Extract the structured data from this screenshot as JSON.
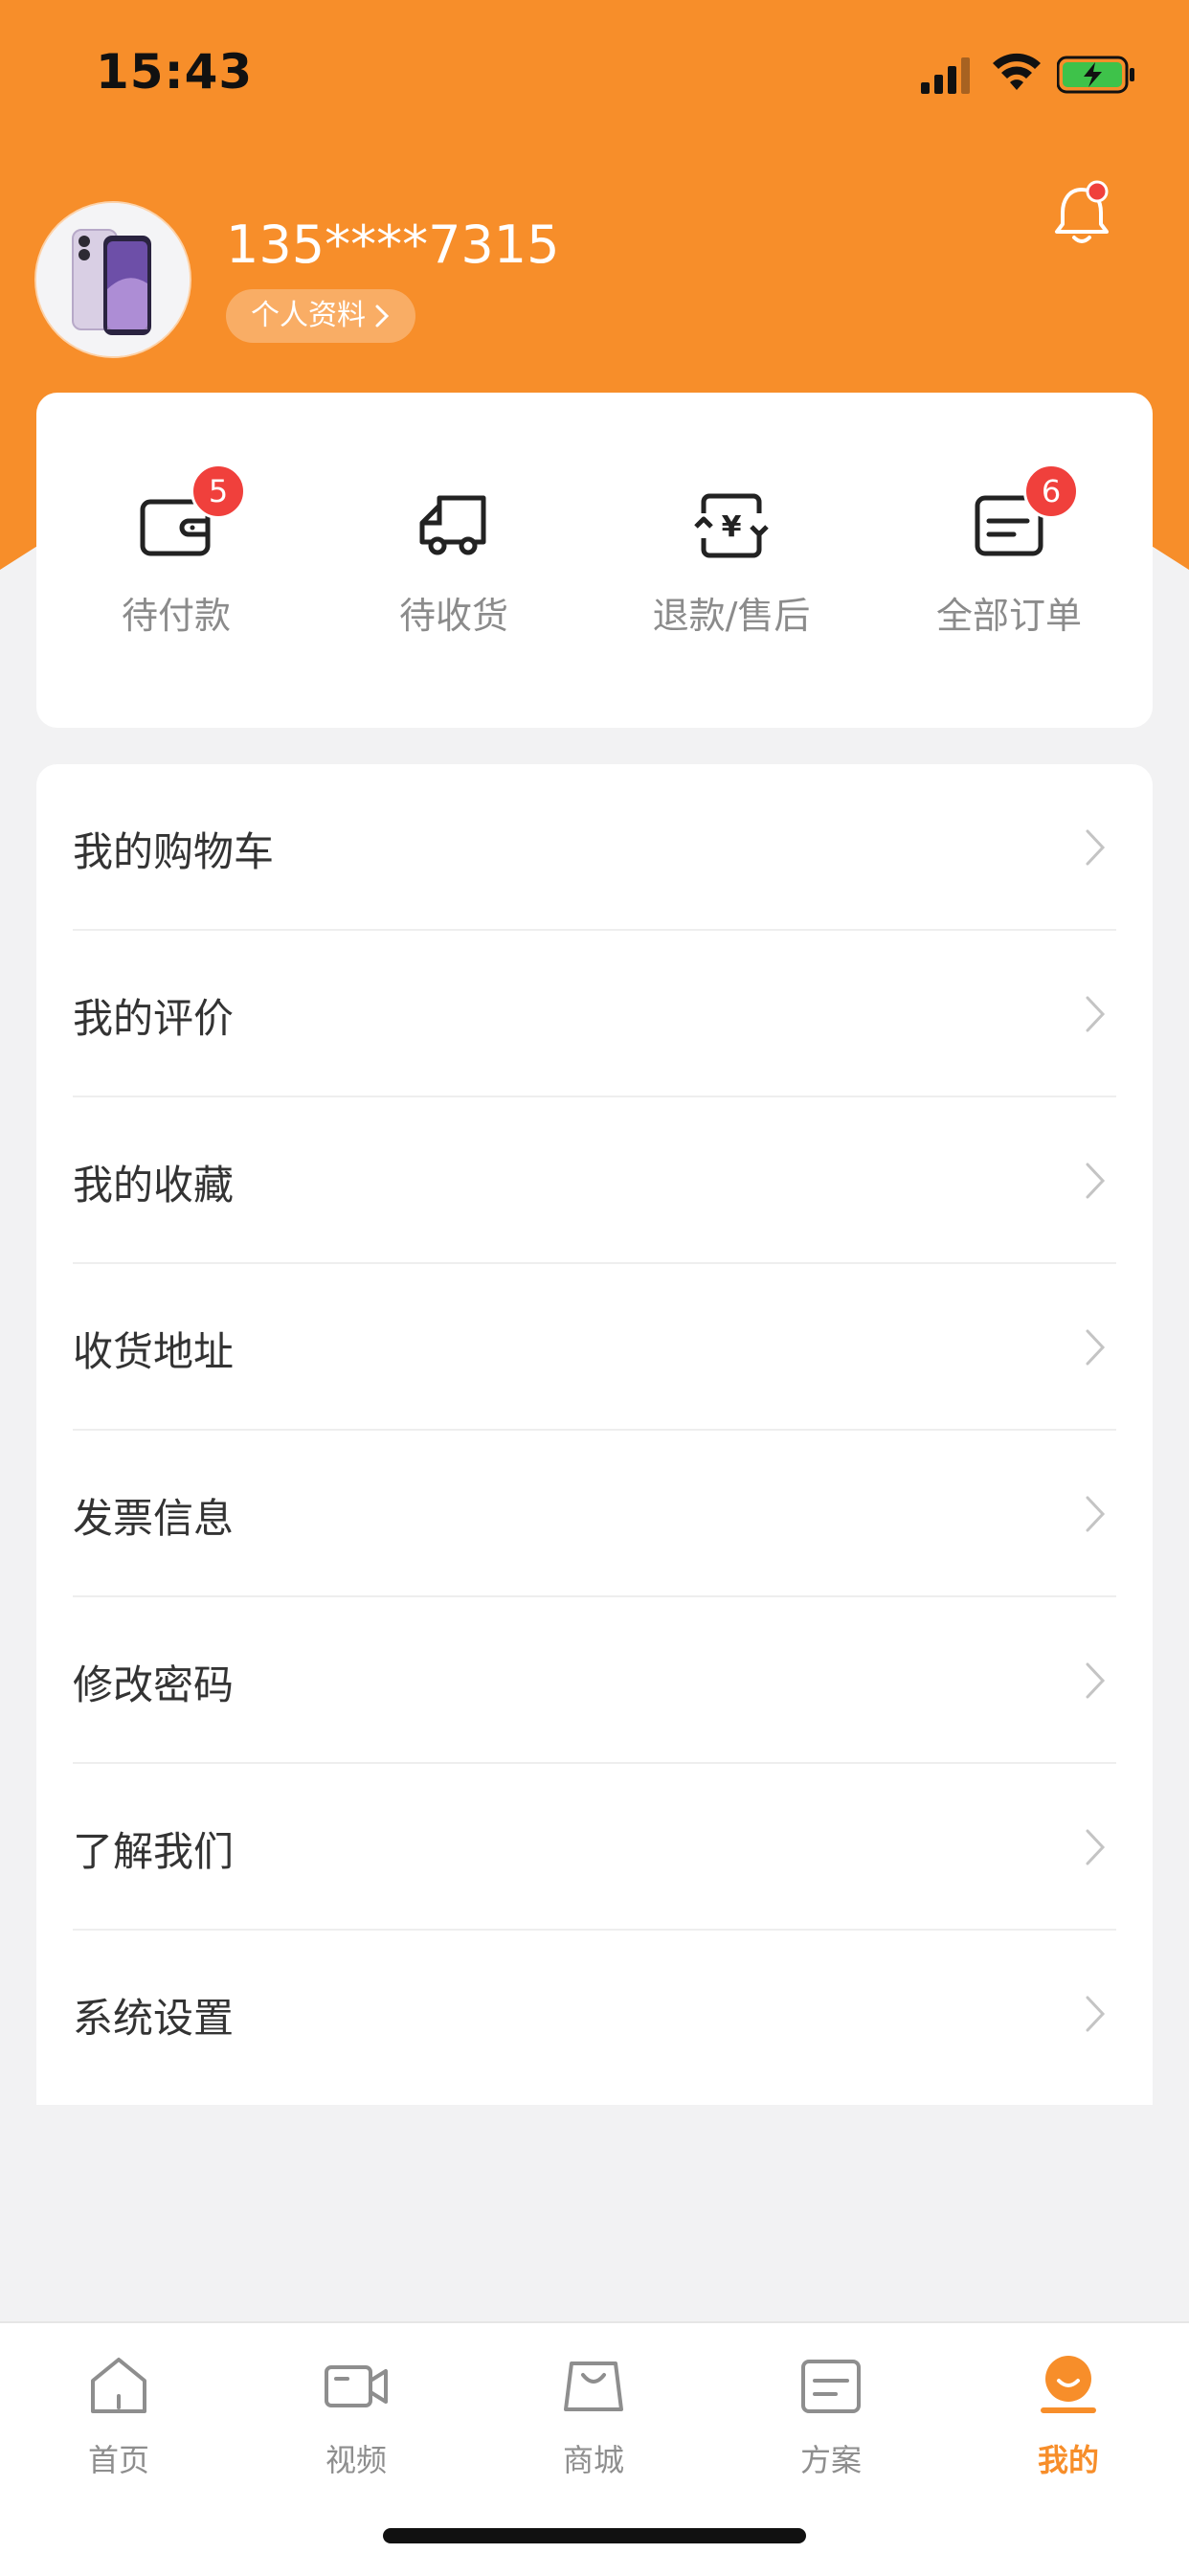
{
  "status_bar": {
    "time": "15:43"
  },
  "profile": {
    "phone": "135****7315",
    "profile_button": "个人资料"
  },
  "orders": [
    {
      "label": "待付款",
      "icon": "wallet-icon",
      "badge": "5"
    },
    {
      "label": "待收货",
      "icon": "delivery-truck-icon",
      "badge": ""
    },
    {
      "label": "退款/售后",
      "icon": "refund-icon",
      "badge": ""
    },
    {
      "label": "全部订单",
      "icon": "order-list-icon",
      "badge": "6"
    }
  ],
  "menu": [
    {
      "label": "我的购物车"
    },
    {
      "label": "我的评价"
    },
    {
      "label": "我的收藏"
    },
    {
      "label": "收货地址"
    },
    {
      "label": "发票信息"
    },
    {
      "label": "修改密码"
    },
    {
      "label": "了解我们"
    },
    {
      "label": "系统设置"
    }
  ],
  "tabs": [
    {
      "label": "首页",
      "icon": "home-icon"
    },
    {
      "label": "视频",
      "icon": "video-icon"
    },
    {
      "label": "商城",
      "icon": "shop-bag-icon"
    },
    {
      "label": "方案",
      "icon": "plan-icon"
    },
    {
      "label": "我的",
      "icon": "profile-icon",
      "active": true
    }
  ],
  "colors": {
    "accent": "#f78e2a",
    "badge": "#f0403c",
    "background": "#f2f2f3"
  }
}
